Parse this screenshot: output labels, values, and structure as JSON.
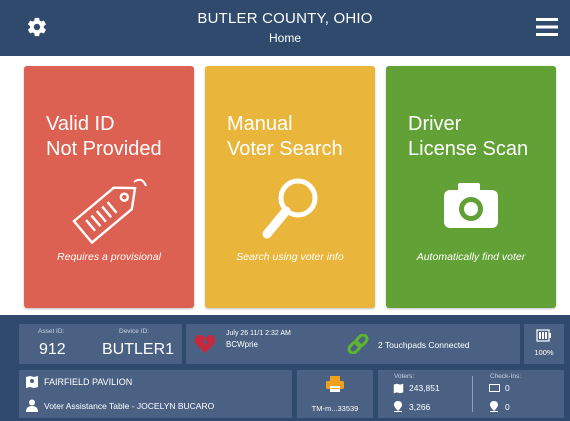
{
  "header": {
    "title": "BUTLER COUNTY, OHIO",
    "subtitle": "Home",
    "settings_icon": "gear-icon",
    "menu_icon": "hamburger-menu-icon"
  },
  "tiles": [
    {
      "title_line1": "Valid ID",
      "title_line2": "Not Provided",
      "caption": "Requires a provisional",
      "icon": "tag-icon",
      "color": "#dc6152"
    },
    {
      "title_line1": "Manual",
      "title_line2": "Voter Search",
      "caption": "Search using voter info",
      "icon": "magnifier-icon",
      "color": "#e9b53b"
    },
    {
      "title_line1": "Driver",
      "title_line2": "License Scan",
      "caption": "Automatically find voter",
      "icon": "camera-icon",
      "color": "#62a136"
    }
  ],
  "status": {
    "asset_id_label": "Asset ID:",
    "asset_id": "912",
    "device_id_label": "Device ID:",
    "device_id": "BUTLER1",
    "heartbeat_time": "July 26 11/1 2:32 AM",
    "heartbeat_name": "BCWprie",
    "touchpads_text": "2 Touchpads Connected",
    "battery_percent": "100%",
    "location": "FAIRFIELD PAVILION",
    "station": "Voter Assistance Table - JOCELYN BUCARO",
    "printer_label": "TM-m...33539",
    "voters_label": "Voters:",
    "voters_count": "243,851",
    "voters_checked": "3,266",
    "checkins_label": "Check-Ins:",
    "checkins_a": "0",
    "checkins_b": "0"
  },
  "colors": {
    "header": "#2f4a6d",
    "panel": "#4a6184",
    "red": "#dc6152",
    "yellow": "#e9b53b",
    "green": "#62a136"
  }
}
